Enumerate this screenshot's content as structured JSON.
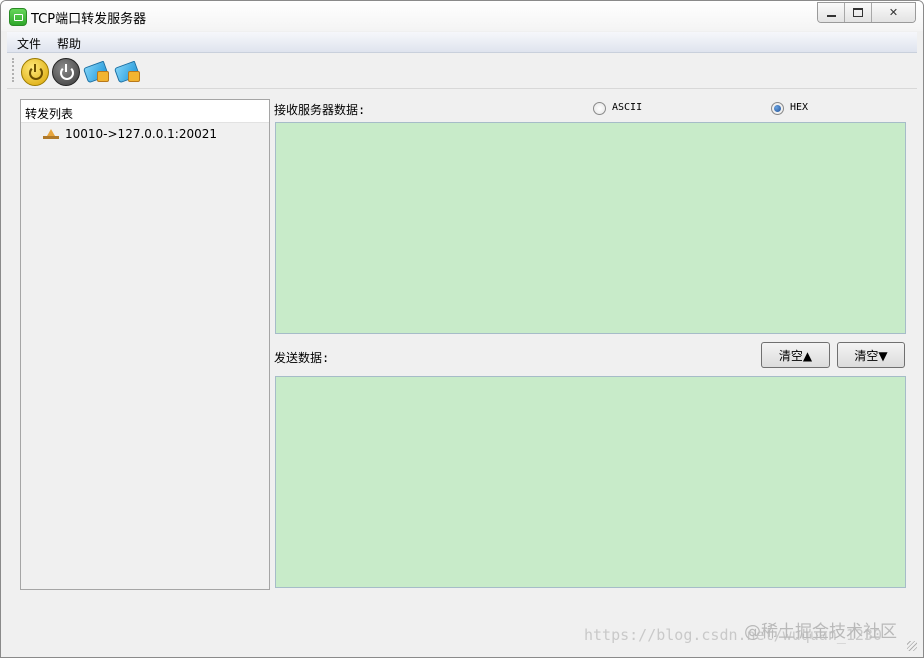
{
  "window": {
    "title": "TCP端口转发服务器",
    "controls": {
      "minimize": "minimize",
      "maximize": "maximize",
      "close": "✕"
    }
  },
  "menu": {
    "items": [
      "文件",
      "帮助"
    ]
  },
  "toolbar": {
    "buttons": [
      {
        "icon": "power-on-icon"
      },
      {
        "icon": "power-off-icon"
      },
      {
        "icon": "tag-icon"
      },
      {
        "icon": "tag-icon"
      }
    ]
  },
  "forward_list": {
    "header": "转发列表",
    "items": [
      {
        "label": "10010->127.0.0.1:20021"
      }
    ]
  },
  "receive": {
    "label": "接收服务器数据:",
    "mode_options": [
      {
        "label": "ASCII",
        "selected": false
      },
      {
        "label": "HEX",
        "selected": true
      }
    ],
    "content": ""
  },
  "send": {
    "label": "发送数据:",
    "clear_up_label": "清空▲",
    "clear_down_label": "清空▼",
    "content": ""
  },
  "watermark": {
    "url": "https://blog.csdn.net/wuquan_1230",
    "brand": "@稀土掘金技术社区"
  },
  "colors": {
    "textarea_bg": "#c8ebc9",
    "window_bg": "#f0f0f0",
    "accent_mark": "#b01b1b"
  }
}
